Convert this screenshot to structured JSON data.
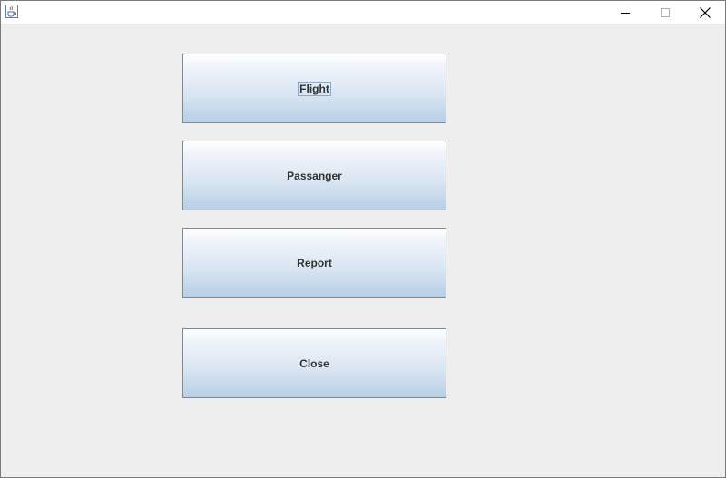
{
  "window": {
    "title": "",
    "controls": {
      "minimize_icon": "minimize-icon",
      "maximize_icon": "maximize-icon",
      "close_icon": "close-icon"
    },
    "app_icon": "java-cup-icon"
  },
  "buttons": {
    "flight": "Flight",
    "passanger": "Passanger",
    "report": "Report",
    "close": "Close"
  },
  "focused_button": "flight",
  "colors": {
    "background": "#eeeeee",
    "button_gradient_top": "#ffffff",
    "button_gradient_bottom": "#b8cfe5",
    "button_border": "#7a8a99",
    "text": "#333333"
  }
}
